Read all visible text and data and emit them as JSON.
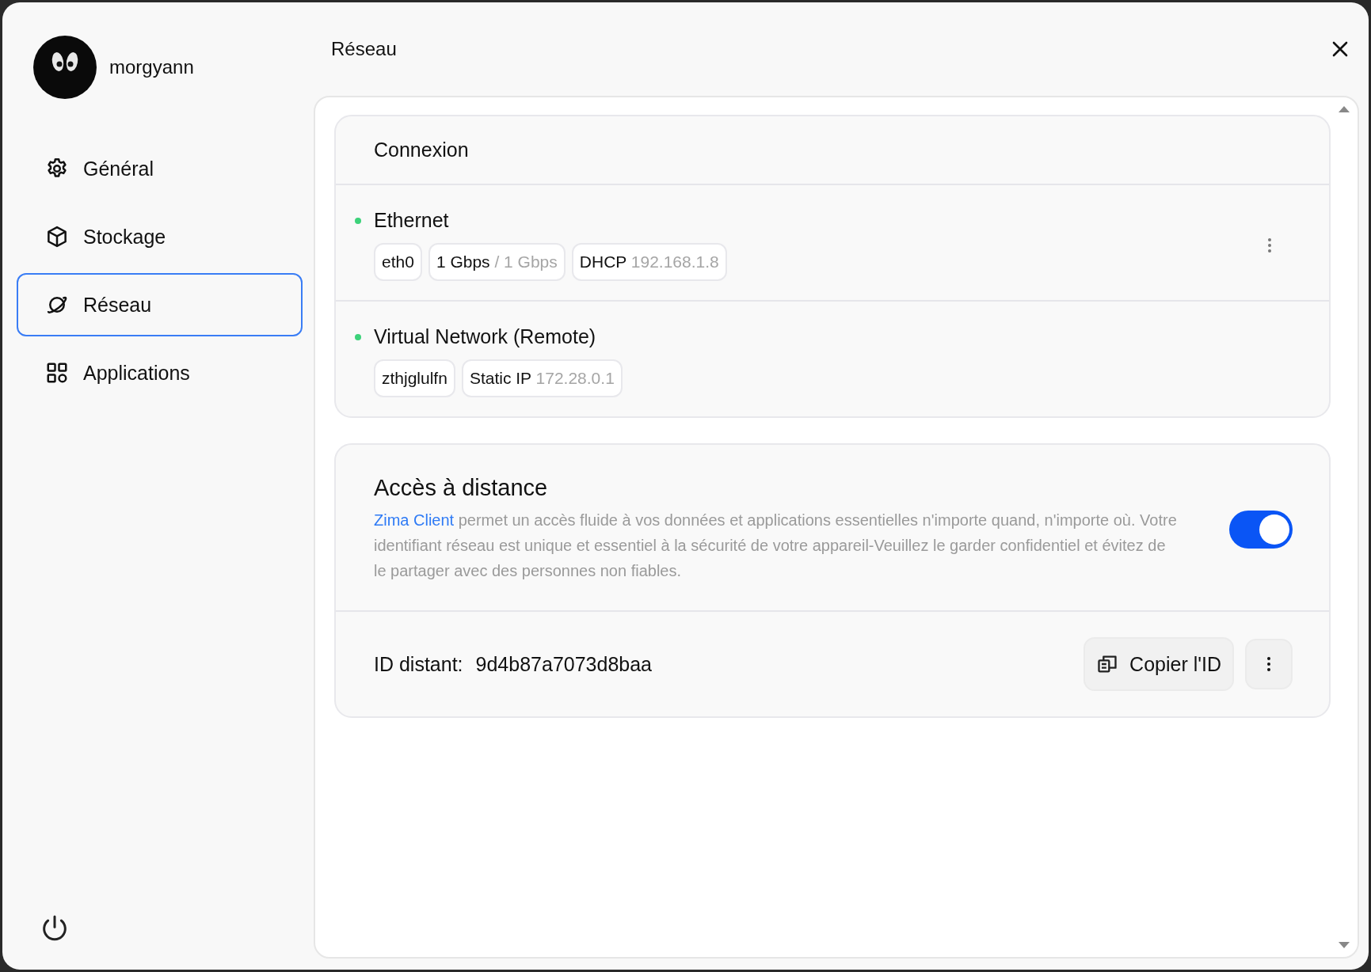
{
  "user": {
    "name": "morgyann"
  },
  "sidebar": {
    "items": [
      {
        "label": "Général",
        "selected": false
      },
      {
        "label": "Stockage",
        "selected": false
      },
      {
        "label": "Réseau",
        "selected": true
      },
      {
        "label": "Applications",
        "selected": false
      }
    ]
  },
  "header": {
    "title": "Réseau"
  },
  "connection": {
    "title": "Connexion",
    "items": [
      {
        "name": "Ethernet",
        "color": "#3dd27a",
        "menu": true,
        "tags": [
          {
            "main": "eth0"
          },
          {
            "main": "1 Gbps",
            "secondary": "/ 1 Gbps"
          },
          {
            "main": "DHCP",
            "secondary": "192.168.1.8"
          }
        ]
      },
      {
        "name": "Virtual Network (Remote)",
        "color": "#3dd27a",
        "menu": false,
        "tags": [
          {
            "main": "zthjglulfn"
          },
          {
            "main": "Static IP",
            "secondary": "172.28.0.1"
          }
        ]
      }
    ]
  },
  "remote_access": {
    "title": "Accès à distance",
    "link": "Zima Client",
    "description": "permet un accès fluide à vos données et applications essentielles n'importe quand, n'importe où. Votre identifiant réseau est unique et essentiel à la sécurité de votre appareil-Veuillez le garder confidentiel et évitez de le partager avec des personnes non fiables.",
    "on": true,
    "id_label": "ID distant:",
    "id_value": "9d4b87a7073d8baa",
    "copy_button": "Copier l'ID"
  }
}
